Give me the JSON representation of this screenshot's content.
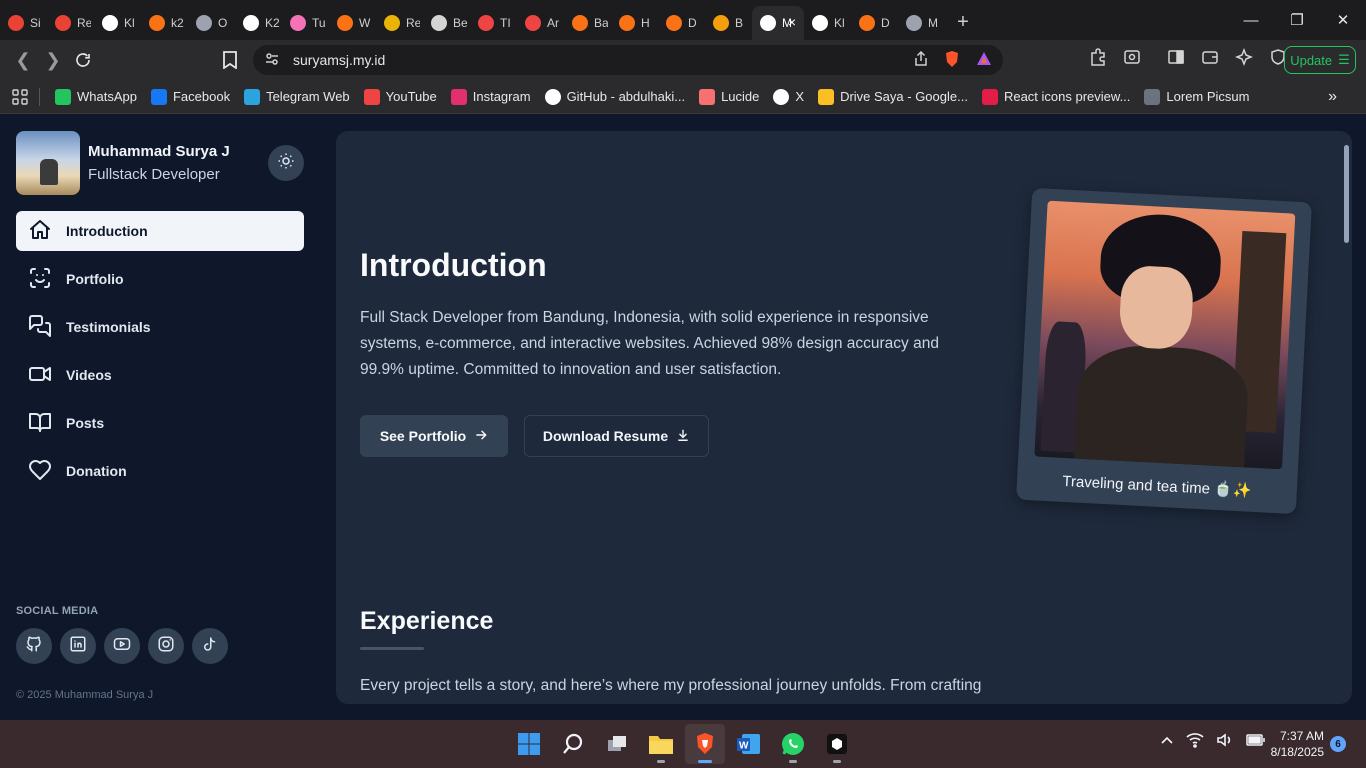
{
  "browser": {
    "tabs": [
      {
        "label": "Si",
        "icon": "gmail-icon",
        "color": "#ea4335"
      },
      {
        "label": "Re",
        "icon": "gmail-icon",
        "color": "#ea4335"
      },
      {
        "label": "Kl",
        "icon": "github-icon",
        "color": "#ffffff"
      },
      {
        "label": "k2",
        "icon": "flame-icon",
        "color": "#f97316"
      },
      {
        "label": "O",
        "icon": "globe-icon",
        "color": "#9ca3af"
      },
      {
        "label": "K2",
        "icon": "triangle-icon",
        "color": "#ffffff"
      },
      {
        "label": "Tu",
        "icon": "circle-icon",
        "color": "#f472b6"
      },
      {
        "label": "W",
        "icon": "circle-icon",
        "color": "#f97316"
      },
      {
        "label": "Re",
        "icon": "circle-icon",
        "color": "#eab308"
      },
      {
        "label": "Be",
        "icon": "openai-icon",
        "color": "#d4d4d4"
      },
      {
        "label": "TI",
        "icon": "youtube-icon",
        "color": "#ef4444"
      },
      {
        "label": "Ar",
        "icon": "angular-icon",
        "color": "#ef4444"
      },
      {
        "label": "Ba",
        "icon": "circle-icon",
        "color": "#f97316"
      },
      {
        "label": "H",
        "icon": "block-icon",
        "color": "#f97316"
      },
      {
        "label": "D",
        "icon": "block-icon",
        "color": "#f97316"
      },
      {
        "label": "B",
        "icon": "circle-icon",
        "color": "#f59e0b"
      },
      {
        "label": "M",
        "icon": "page-icon",
        "color": "#ffffff",
        "active": true
      },
      {
        "label": "Kl",
        "icon": "github-icon",
        "color": "#ffffff"
      },
      {
        "label": "D",
        "icon": "block-icon",
        "color": "#f97316"
      },
      {
        "label": "M",
        "icon": "globe-icon",
        "color": "#9ca3af"
      }
    ],
    "url": "suryamsj.my.id",
    "update_label": "Update",
    "bookmarks": [
      {
        "label": "WhatsApp",
        "icon": "whatsapp-icon",
        "color": "#22c55e"
      },
      {
        "label": "Facebook",
        "icon": "facebook-icon",
        "color": "#1877f2"
      },
      {
        "label": "Telegram Web",
        "icon": "telegram-icon",
        "color": "#2aa3df"
      },
      {
        "label": "YouTube",
        "icon": "youtube-icon",
        "color": "#ef4444"
      },
      {
        "label": "Instagram",
        "icon": "instagram-icon",
        "color": "#e1306c"
      },
      {
        "label": "GitHub - abdulhaki...",
        "icon": "github-icon",
        "color": "#ffffff"
      },
      {
        "label": "Lucide",
        "icon": "lucide-icon",
        "color": "#f87171"
      },
      {
        "label": "X",
        "icon": "x-icon",
        "color": "#ffffff"
      },
      {
        "label": "Drive Saya - Google...",
        "icon": "drive-icon",
        "color": "#fbbf24"
      },
      {
        "label": "React icons preview...",
        "icon": "react-icon",
        "color": "#e11d48"
      },
      {
        "label": "Lorem Picsum",
        "icon": "page-icon",
        "color": "#6b7280"
      }
    ]
  },
  "sidebar": {
    "name": "Muhammad Surya J",
    "role": "Fullstack Developer",
    "nav": [
      {
        "label": "Introduction",
        "icon": "home-icon",
        "active": true
      },
      {
        "label": "Portfolio",
        "icon": "scan-face-icon"
      },
      {
        "label": "Testimonials",
        "icon": "messages-icon"
      },
      {
        "label": "Videos",
        "icon": "video-icon"
      },
      {
        "label": "Posts",
        "icon": "book-open-icon"
      },
      {
        "label": "Donation",
        "icon": "heart-icon"
      }
    ],
    "social_title": "SOCIAL MEDIA",
    "socials": [
      "github-icon",
      "linkedin-icon",
      "youtube-icon",
      "instagram-icon",
      "tiktok-icon"
    ],
    "copyright": "© 2025 Muhammad Surya J"
  },
  "main": {
    "title": "Introduction",
    "intro": "Full Stack Developer from Bandung, Indonesia, with solid experience in responsive systems, e-commerce, and interactive websites. Achieved 98% design accuracy and 99.9% uptime. Committed to innovation and user satisfaction.",
    "primary_btn": "See Portfolio",
    "secondary_btn": "Download Resume",
    "photo_caption": "Traveling and tea time 🍵✨",
    "experience_title": "Experience",
    "experience_text": "Every project tells a story, and here’s where my professional journey unfolds. From crafting"
  },
  "taskbar": {
    "time": "7:37 AM",
    "date": "8/18/2025",
    "notifications": "6"
  },
  "colors": {
    "page_bg": "#0f172a",
    "card_bg": "#1e293b",
    "button_bg": "#334155",
    "update_green": "#22c55e"
  }
}
